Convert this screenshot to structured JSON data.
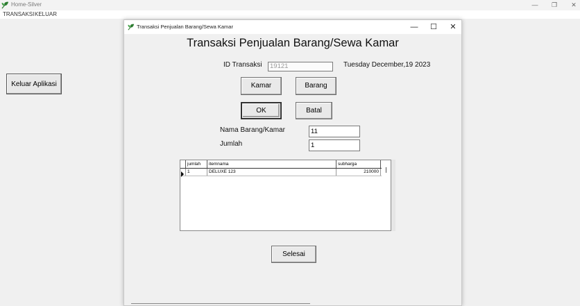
{
  "main_window": {
    "title": "Home-Silver",
    "controls": {
      "minimize": "—",
      "restore": "❐",
      "close": "✕"
    },
    "menu": [
      "TRANSAKSI",
      "KELUAR"
    ],
    "exit_button_label": "Keluar Aplikasi"
  },
  "dialog": {
    "title": "Transaksi Penjualan Barang/Sewa Kamar",
    "controls": {
      "minimize": "—",
      "maximize": "☐",
      "close": "✕"
    },
    "heading": "Transaksi Penjualan Barang/Sewa Kamar",
    "id_label": "ID Transaksi",
    "id_value": "19121",
    "date": "Tuesday December,19 2023",
    "buttons": {
      "kamar": "Kamar",
      "barang": "Barang",
      "ok": "OK",
      "batal": "Batal",
      "selesai": "Selesai"
    },
    "nama_label": "Nama Barang/Kamar",
    "nama_value": "11",
    "jumlah_label": "Jumlah",
    "jumlah_value": "1",
    "grid": {
      "columns": [
        "jumlah",
        "itemnama",
        "subharga"
      ],
      "rows": [
        {
          "jumlah": "1",
          "itemnama": "DELUXE 123",
          "subharga": "210000"
        }
      ]
    }
  },
  "colors": {
    "app_icon": "#2e7d32",
    "dialog_bg": "#f0f0f0",
    "field_border": "#7a7a7a"
  }
}
